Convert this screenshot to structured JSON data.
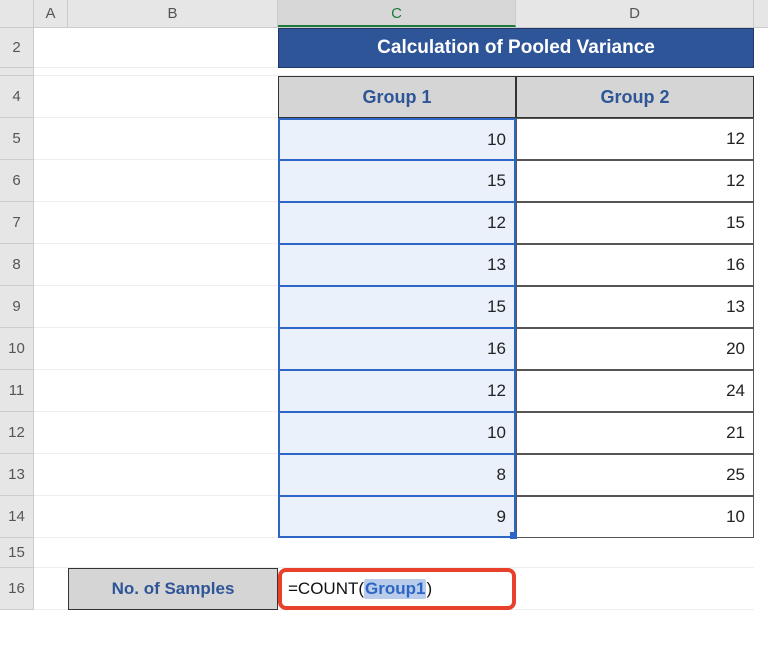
{
  "columns": {
    "A": "A",
    "B": "B",
    "C": "C",
    "D": "D"
  },
  "rows": [
    "2",
    "",
    "4",
    "5",
    "6",
    "7",
    "8",
    "9",
    "10",
    "11",
    "12",
    "13",
    "14",
    "15",
    "16"
  ],
  "title": "Calculation of Pooled Variance",
  "headers": {
    "g1": "Group 1",
    "g2": "Group 2"
  },
  "chart_data": {
    "type": "table",
    "title": "Calculation of Pooled Variance",
    "series": [
      {
        "name": "Group 1",
        "values": [
          10,
          15,
          12,
          13,
          15,
          16,
          12,
          10,
          8,
          9
        ]
      },
      {
        "name": "Group 2",
        "values": [
          12,
          12,
          15,
          16,
          13,
          20,
          24,
          21,
          25,
          10
        ]
      }
    ]
  },
  "labels": {
    "samples": "No. of Samples"
  },
  "formula": {
    "prefix": "=COUNT(",
    "arg": "Group1",
    "suffix": ")"
  }
}
